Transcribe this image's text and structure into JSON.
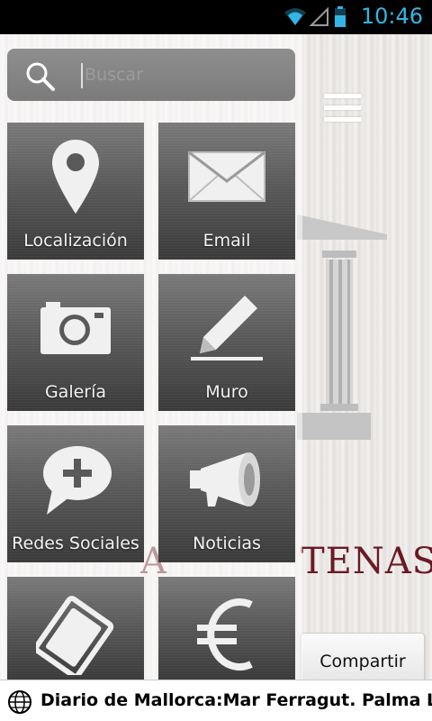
{
  "status_bar": {
    "time": "10:46",
    "icons": [
      "wifi-icon",
      "signal-icon",
      "battery-icon"
    ],
    "accent_color": "#33b5e5"
  },
  "search": {
    "placeholder": "Buscar",
    "value": ""
  },
  "menu_tiles": [
    {
      "label": "Localización",
      "icon": "location-pin-icon"
    },
    {
      "label": "Email",
      "icon": "envelope-icon"
    },
    {
      "label": "Galería",
      "icon": "camera-icon"
    },
    {
      "label": "Muro",
      "icon": "pencil-icon"
    },
    {
      "label": "Redes Sociales",
      "icon": "speech-bubble-plus-icon"
    },
    {
      "label": "Noticias",
      "icon": "megaphone-icon"
    },
    {
      "label": "",
      "icon": "tickets-icon"
    },
    {
      "label": "",
      "icon": "euro-icon"
    }
  ],
  "background": {
    "brand_text_right": "TENAS",
    "brand_text_left": "A",
    "share_button_label": "Compartir",
    "brand_color": "#6a1a24"
  },
  "ticker": {
    "text": "Diario de Mallorca:Mar Ferragut. Palma La enseñ"
  }
}
